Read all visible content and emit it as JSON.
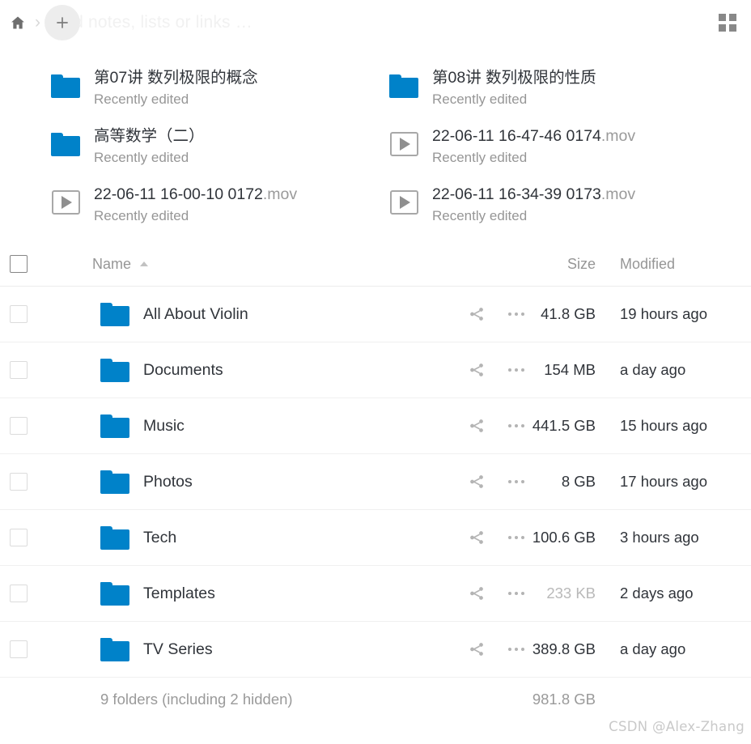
{
  "header": {
    "home_icon": "home-icon",
    "separator": "›",
    "new_button_label": "+",
    "ghost_placeholder": "Add notes, lists or links …",
    "view_toggle_icon": "grid-view-icon"
  },
  "recent": {
    "items": [
      {
        "icon": "folder-icon",
        "name": "第07讲 数列极限的概念",
        "ext": "",
        "status": "Recently edited"
      },
      {
        "icon": "folder-icon",
        "name": "第08讲 数列极限的性质",
        "ext": "",
        "status": "Recently edited"
      },
      {
        "icon": "folder-icon",
        "name": "高等数学（二）",
        "ext": "",
        "status": "Recently edited"
      },
      {
        "icon": "video-icon",
        "name": "22-06-11 16-47-46 0174",
        "ext": ".mov",
        "status": "Recently edited"
      },
      {
        "icon": "video-icon",
        "name": "22-06-11 16-00-10 0172",
        "ext": ".mov",
        "status": "Recently edited"
      },
      {
        "icon": "video-icon",
        "name": "22-06-11 16-34-39 0173",
        "ext": ".mov",
        "status": "Recently edited"
      }
    ]
  },
  "table": {
    "columns": {
      "name": "Name",
      "size": "Size",
      "modified": "Modified"
    },
    "sort": {
      "column": "Name",
      "direction": "ascending",
      "icon": "sort-ascending-icon"
    },
    "select_all": "select-all-checkbox",
    "row_actions": {
      "share": "share-icon",
      "menu": "more-actions-icon"
    },
    "rows": [
      {
        "icon": "folder-icon",
        "name": "All About Violin",
        "size": "41.8 GB",
        "size_dim": false,
        "modified": "19 hours ago"
      },
      {
        "icon": "folder-icon",
        "name": "Documents",
        "size": "154 MB",
        "size_dim": false,
        "modified": "a day ago"
      },
      {
        "icon": "folder-icon",
        "name": "Music",
        "size": "441.5 GB",
        "size_dim": false,
        "modified": "15 hours ago"
      },
      {
        "icon": "folder-icon",
        "name": "Photos",
        "size": "8 GB",
        "size_dim": false,
        "modified": "17 hours ago"
      },
      {
        "icon": "folder-icon",
        "name": "Tech",
        "size": "100.6 GB",
        "size_dim": false,
        "modified": "3 hours ago"
      },
      {
        "icon": "folder-icon",
        "name": "Templates",
        "size": "233 KB",
        "size_dim": true,
        "modified": "2 days ago"
      },
      {
        "icon": "folder-icon",
        "name": "TV Series",
        "size": "389.8 GB",
        "size_dim": false,
        "modified": "a day ago"
      }
    ],
    "footer": {
      "summary": "9 folders (including 2 hidden)",
      "total_size": "981.8 GB"
    }
  },
  "watermark": "CSDN @Alex-Zhang",
  "colors": {
    "folder_blue": "#0082c9",
    "text": "#30343a",
    "muted": "#969696",
    "divider": "#f0f0f0"
  }
}
